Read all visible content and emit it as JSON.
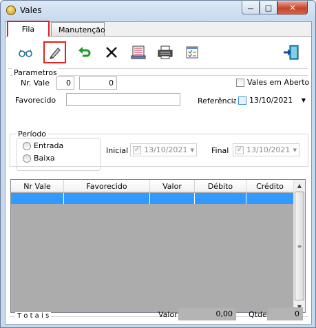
{
  "window": {
    "title": "Vales",
    "minimize_glyph": "—",
    "maximize_glyph": "□",
    "close_glyph": "✕"
  },
  "tabs": [
    {
      "label": "Fila",
      "active": true
    },
    {
      "label": "Manutenção",
      "active": false
    }
  ],
  "toolbar": {
    "icons": [
      "glasses-icon",
      "pencil-icon",
      "undo-arrow-icon",
      "delete-x-icon",
      "report-icon",
      "printer-icon",
      "checklist-icon",
      "exit-door-icon"
    ],
    "highlight_color": "#e02020"
  },
  "parametros": {
    "group_label": "Parametros",
    "nr_vale_label": "Nr. Vale",
    "nr_vale_from": "0",
    "nr_vale_to": "0",
    "vales_em_aberto_label": "Vales em Aberto",
    "favorecido_label": "Favorecido",
    "favorecido_value": "",
    "referencia_label": "Referência",
    "referencia_date": "13/10/2021"
  },
  "periodo": {
    "group_label": "Período",
    "options": [
      {
        "label": "Entrada"
      },
      {
        "label": "Baixa"
      }
    ],
    "inicial_label": "Inicial",
    "inicial_date": "13/10/2021",
    "final_label": "Final",
    "final_date": "13/10/2021"
  },
  "grid": {
    "columns": [
      "Nr Vale",
      "Favorecido",
      "Valor",
      "Débito",
      "Crédito"
    ],
    "selected_row_color": "#3399ff"
  },
  "totais": {
    "label": "T o t a i s",
    "valor_label": "Valor",
    "valor_value": "0,00",
    "qtde_label": "Qtde",
    "qtde_value": "0"
  }
}
